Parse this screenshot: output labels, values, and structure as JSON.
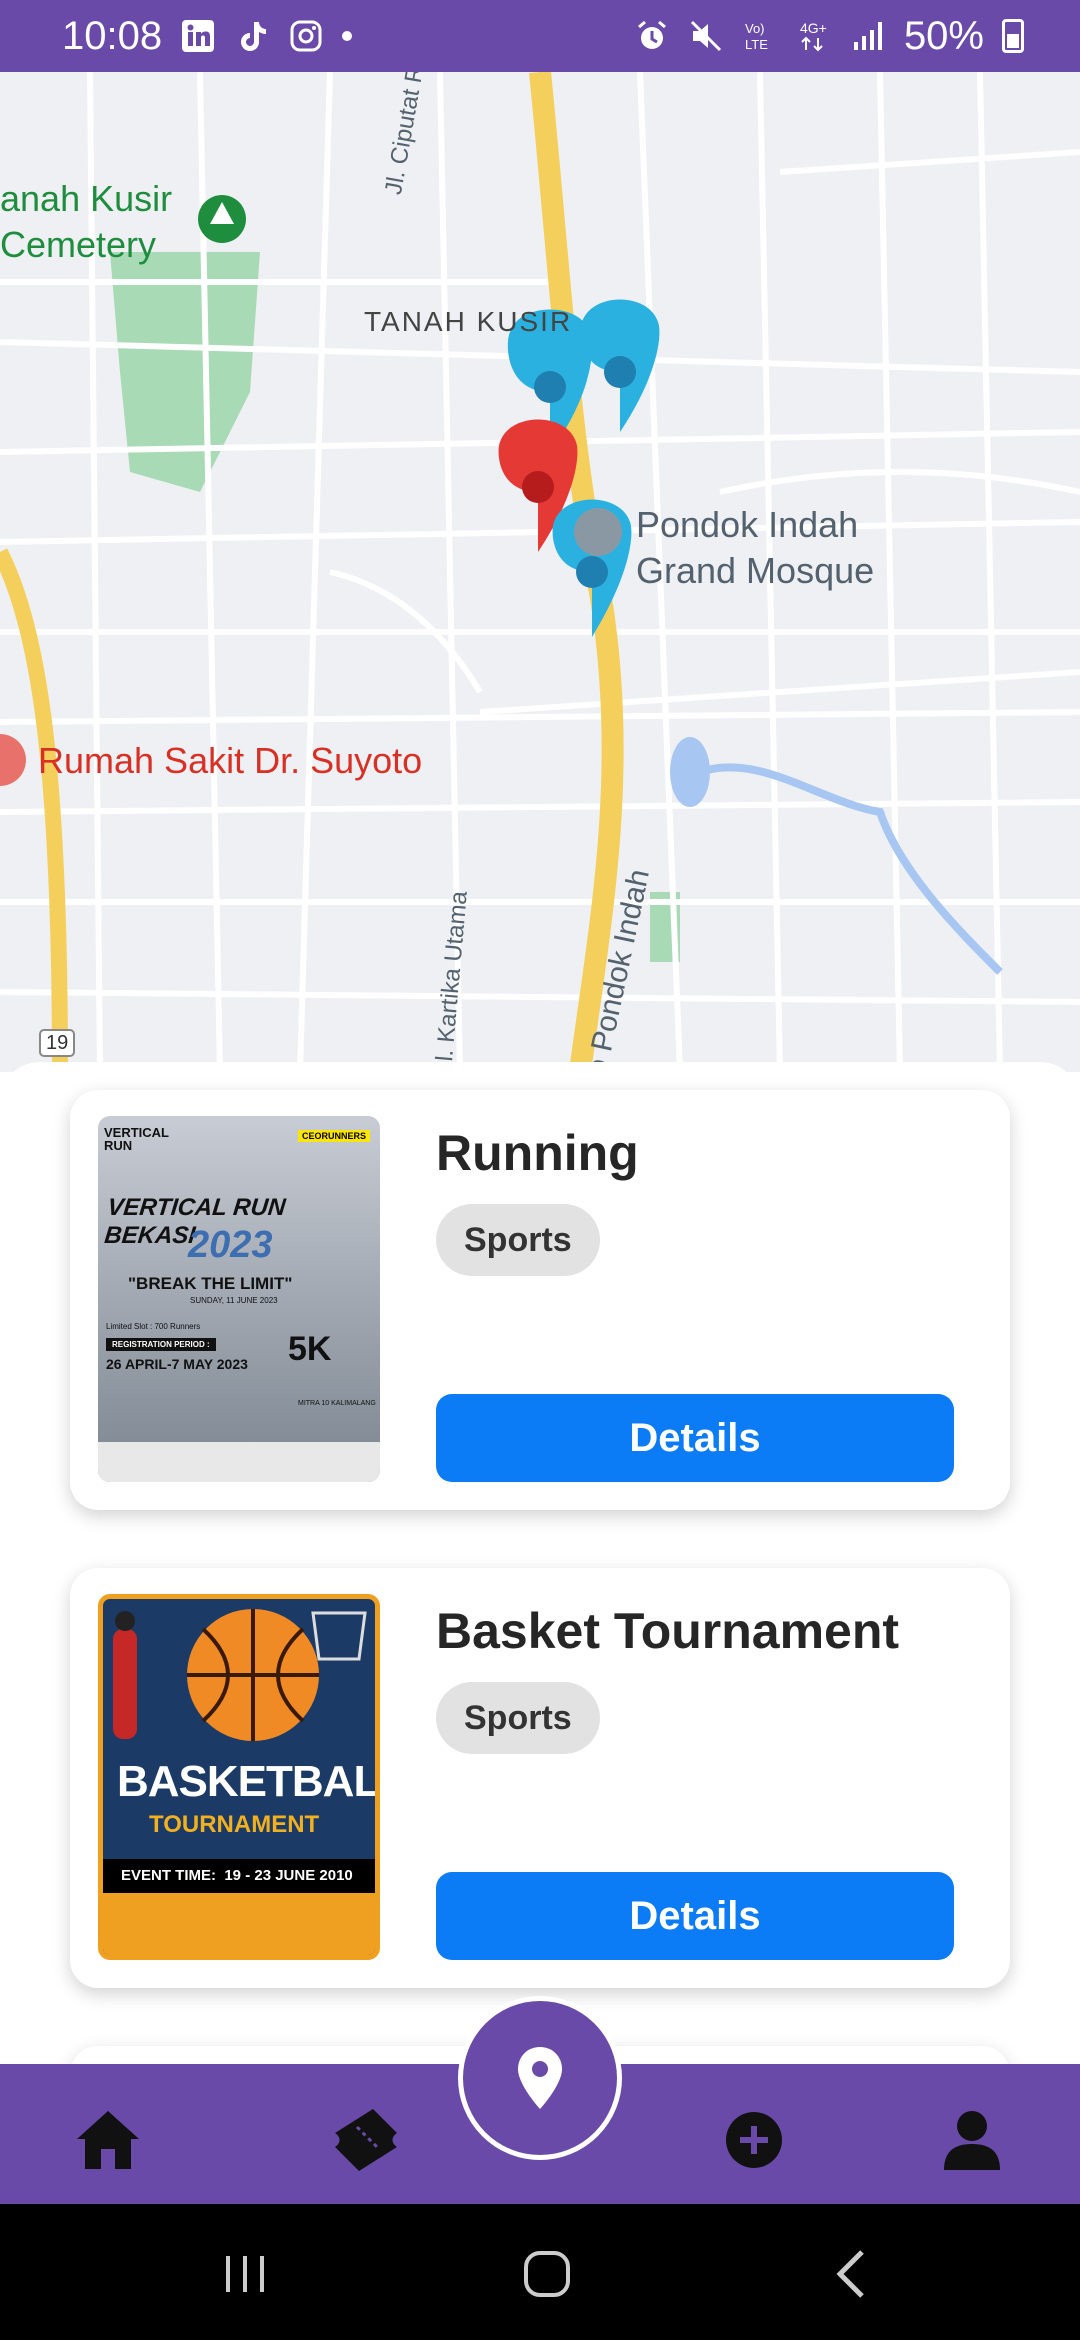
{
  "status_bar": {
    "time": "10:08",
    "battery": "50%"
  },
  "map": {
    "labels": {
      "cemetery_line1": "anah Kusir",
      "cemetery_line2": "Cemetery",
      "district": "TANAH KUSIR",
      "mosque_line1": "Pondok Indah",
      "mosque_line2": "Grand Mosque",
      "hospital": "Rumah Sakit Dr. Suyoto",
      "road_ciputat": "Jl. Ciputat Raya",
      "road_kartika": "Jl. Kartika Utama",
      "road_pondok": "o Pondok Indah",
      "route_badge": "19"
    },
    "colors": {
      "marker_blue": "#2bb1e0",
      "marker_red": "#e53935"
    }
  },
  "events": [
    {
      "title": "Running",
      "category": "Sports",
      "details_label": "Details",
      "poster": {
        "brand": "VERTICAL RUN",
        "sponsor": "CEORUNNERS",
        "headline": "VERTICAL RUN BEKASI",
        "year": "2023",
        "tagline": "\"BREAK THE LIMIT\"",
        "date": "SUNDAY, 11 JUNE 2023",
        "limit": "Limited Slot : 700 Runners",
        "period_label": "REGISTRATION PERIOD :",
        "period": "26 APRIL-7 MAY 2023",
        "distance": "5K",
        "venue": "MITRA 10 KALIMALANG"
      }
    },
    {
      "title": "Basket Tournament",
      "category": "Sports",
      "details_label": "Details",
      "poster": {
        "line1": "BASKETBALL",
        "line2": "TOURNAMENT",
        "event_time": "EVENT TIME:  19 - 23 JUNE 2010"
      }
    }
  ],
  "bottom_nav": {
    "items": [
      "home-icon",
      "ticket-icon",
      "location-pin-icon",
      "add-circle-icon",
      "profile-icon"
    ],
    "active": "location-pin-icon"
  }
}
